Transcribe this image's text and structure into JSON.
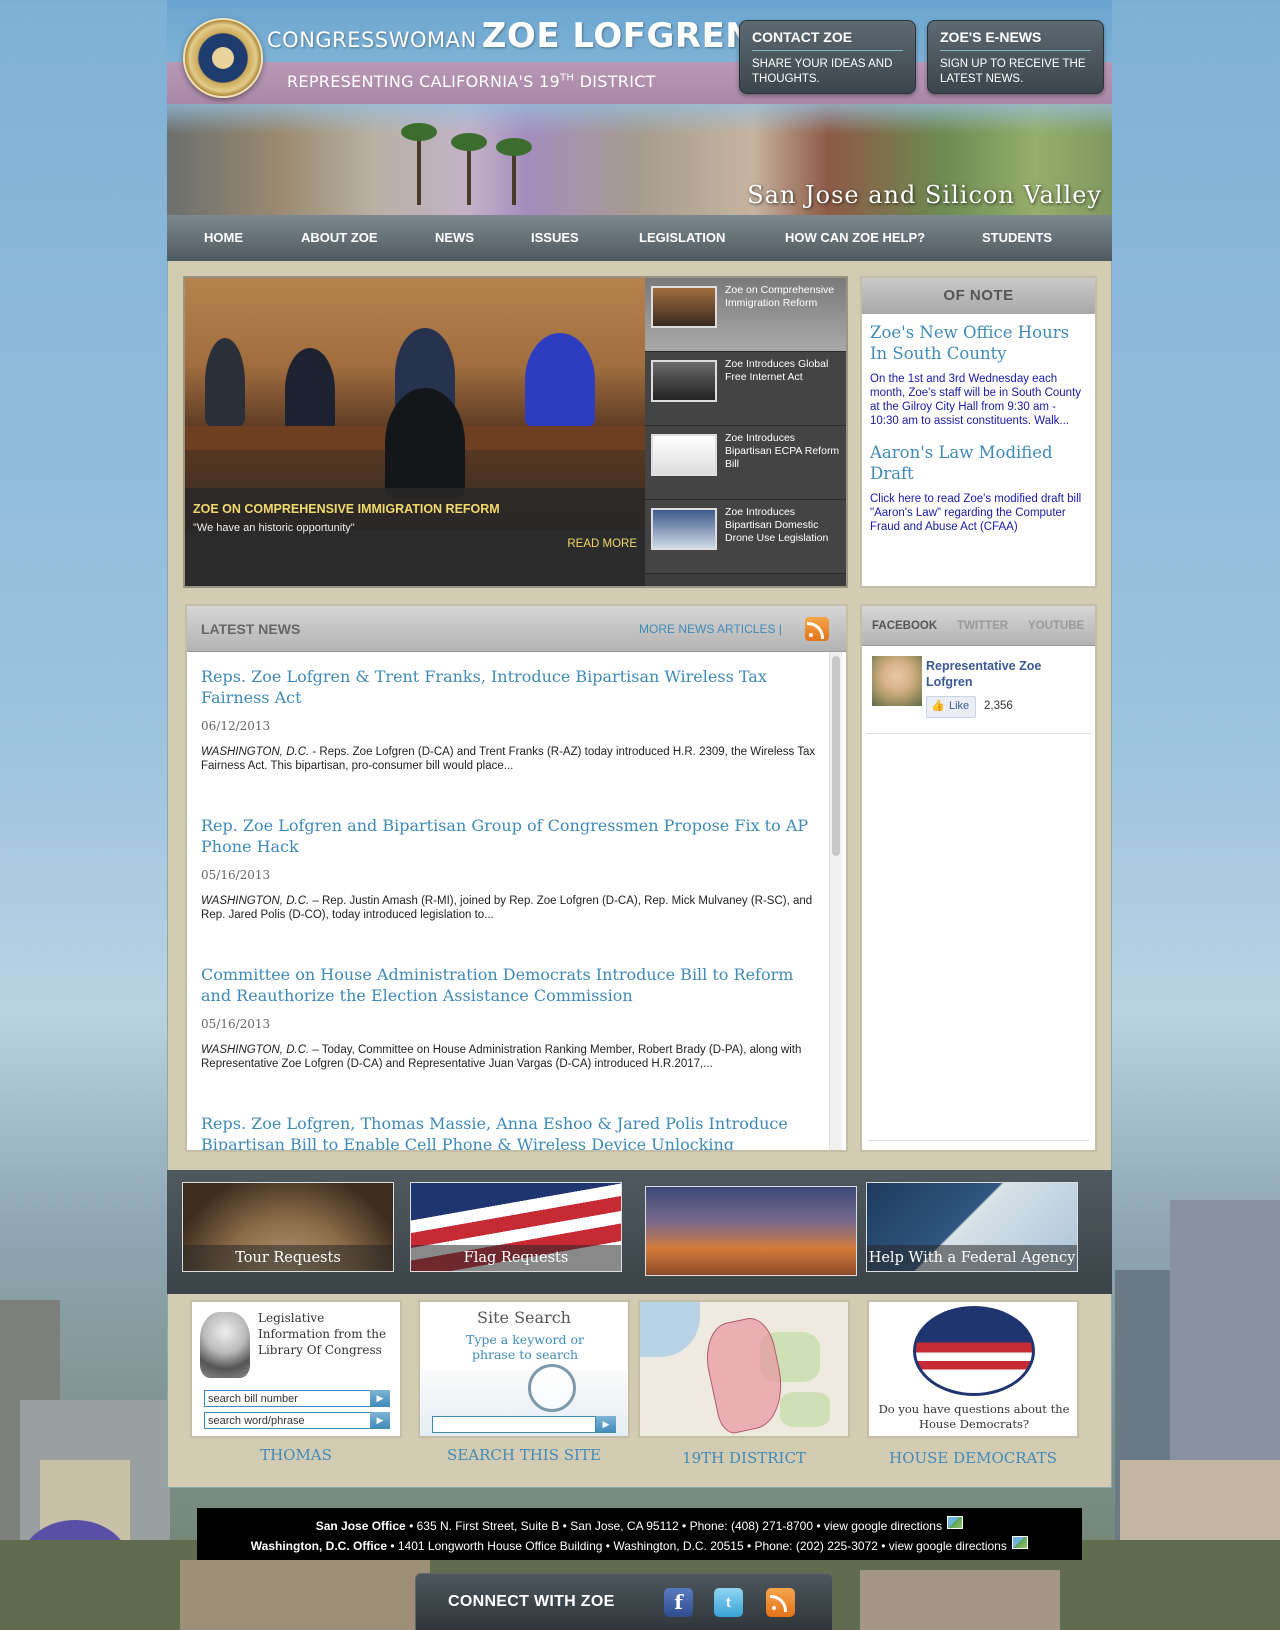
{
  "header": {
    "title_prefix": "CONGRESSWOMAN",
    "title_name": "ZOE LOFGREN",
    "tagline_pre": "REPRESENTING CALIFORNIA'S 19",
    "tagline_sup": "TH",
    "tagline_post": " DISTRICT",
    "seal_text": "U.S. HOUSE OF REPRESENTATIVES",
    "contact": {
      "title": "CONTACT ZOE",
      "subtitle": "SHARE YOUR IDEAS AND THOUGHTS."
    },
    "enews": {
      "title": "ZOE'S E-NEWS",
      "subtitle": "SIGN UP TO RECEIVE THE LATEST NEWS."
    },
    "banner_caption": "San Jose and Silicon Valley"
  },
  "nav": [
    "HOME",
    "ABOUT ZOE",
    "NEWS",
    "ISSUES",
    "LEGISLATION",
    "HOW CAN ZOE HELP?",
    "STUDENTS"
  ],
  "slider": {
    "caption_title": "ZOE ON COMPREHENSIVE IMMIGRATION REFORM",
    "caption_text": "\"We have an historic opportunity\"",
    "read_more": "READ MORE",
    "thumbs": [
      "Zoe on Comprehensive Immigration Reform",
      "Zoe Introduces Global Free Internet Act",
      "Zoe Introduces Bipartisan ECPA Reform Bill",
      "Zoe Introduces Bipartisan Domestic Drone Use Legislation"
    ]
  },
  "of_note": {
    "heading": "OF NOTE",
    "items": [
      {
        "title": "Zoe's New Office Hours In South County",
        "body": "On the 1st and 3rd Wednesday each month, Zoe's staff will be in South County at the Gilroy City Hall from 9:30 am - 10:30 am to assist constituents. Walk..."
      },
      {
        "title": "Aaron's Law Modified Draft",
        "body": "Click here to read Zoe's modified draft bill \"Aaron's Law\" regarding the Computer Fraud and Abuse Act (CFAA)"
      }
    ]
  },
  "news": {
    "heading": "LATEST NEWS",
    "more": "MORE NEWS ARTICLES |",
    "articles": [
      {
        "title": "Reps. Zoe Lofgren & Trent Franks, Introduce Bipartisan Wireless Tax Fairness Act",
        "date": "06/12/2013",
        "dateline": "WASHINGTON, D.C.",
        "body": " - Reps. Zoe Lofgren (D-CA) and Trent Franks (R-AZ) today introduced H.R. 2309, the Wireless Tax Fairness Act. This bipartisan, pro-consumer bill would place..."
      },
      {
        "title": "Rep. Zoe Lofgren and Bipartisan Group of Congressmen Propose Fix to AP Phone Hack",
        "date": "05/16/2013",
        "dateline": "WASHINGTON, D.C.",
        "body": " – Rep. Justin Amash (R-MI), joined by Rep. Zoe Lofgren (D-CA), Rep. Mick Mulvaney (R-SC), and Rep. Jared Polis (D-CO), today introduced legislation to..."
      },
      {
        "title": "Committee on House Administration Democrats Introduce Bill to Reform and Reauthorize the Election Assistance Commission",
        "date": "05/16/2013",
        "dateline": "WASHINGTON, D.C.",
        "body": " – Today, Committee on House Administration Ranking Member, Robert Brady (D-PA), along with Representative Zoe Lofgren (D-CA) and Representative Juan Vargas (D-CA) introduced H.R.2017,..."
      },
      {
        "title": "Reps. Zoe Lofgren, Thomas Massie, Anna Eshoo & Jared Polis Introduce Bipartisan Bill to Enable Cell Phone & Wireless Device Unlocking",
        "date": "",
        "dateline": "",
        "body": ""
      }
    ]
  },
  "social": {
    "tabs": [
      "FACEBOOK",
      "TWITTER",
      "YOUTUBE"
    ],
    "fb_name": "Representative Zoe Lofgren",
    "fb_like": "Like",
    "fb_count": "2,356"
  },
  "features": [
    "Tour Requests",
    "Flag Requests",
    "",
    "Help With a Federal Agency"
  ],
  "links": {
    "thomas": {
      "title": "Legislative Information from the Library Of Congress",
      "input1": "search bill number",
      "input2": "search word/phrase",
      "caption": "THOMAS"
    },
    "search": {
      "title": "Site Search",
      "subtitle": "Type a keyword or phrase to search",
      "caption": "SEARCH THIS SITE"
    },
    "district": {
      "caption": "19TH DISTRICT"
    },
    "democrats": {
      "text": "Do you have questions about the House Democrats?",
      "caption": "HOUSE DEMOCRATS"
    }
  },
  "footer": {
    "sj_label": "San Jose Office",
    "sj_text": " • 635 N. First Street, Suite B • San Jose, CA 95112 • Phone: (408) 271-8700 • ",
    "dc_label": "Washington, D.C. Office",
    "dc_text": " • 1401 Longworth House Office Building • Washington, D.C. 20515 • Phone: (202) 225-3072 • ",
    "directions": "view google directions",
    "connect": "CONNECT WITH ZOE"
  },
  "colors": {
    "link_blue": "#3f8ab9",
    "nav_gray": "#4f5a60",
    "panel_tan": "#d4ccb2",
    "caption_yellow": "#f3d96b"
  },
  "icons": [
    "seal-icon",
    "rss-icon",
    "facebook-icon",
    "twitter-icon",
    "rss-icon",
    "map-icon",
    "like-icon"
  ]
}
